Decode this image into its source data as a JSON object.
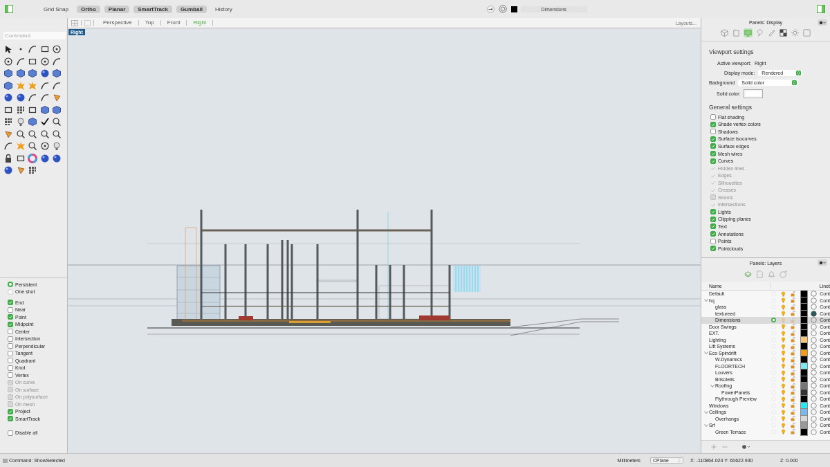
{
  "toolbar": {
    "toggles": [
      {
        "label": "Grid Snap",
        "on": false
      },
      {
        "label": "Ortho",
        "on": true
      },
      {
        "label": "Planar",
        "on": true
      },
      {
        "label": "SmartTrack",
        "on": true
      },
      {
        "label": "Gumball",
        "on": true
      },
      {
        "label": "History",
        "on": false
      }
    ],
    "current_layer": {
      "name": "Dimensions",
      "color": "#000000"
    }
  },
  "command": {
    "placeholder": "Command"
  },
  "viewport_tabs": [
    {
      "label": "Perspective",
      "selected": false
    },
    {
      "label": "Top",
      "selected": false
    },
    {
      "label": "Front",
      "selected": false
    },
    {
      "label": "Right",
      "selected": true
    }
  ],
  "layouts_button": "Layouts...",
  "viewport": {
    "label": "Right"
  },
  "osnaps": {
    "modes": [
      {
        "label": "Persistent",
        "selected": true
      },
      {
        "label": "One shot",
        "selected": false
      }
    ],
    "snaps": [
      {
        "label": "End",
        "checked": true,
        "disabled": false
      },
      {
        "label": "Near",
        "checked": false,
        "disabled": false
      },
      {
        "label": "Point",
        "checked": true,
        "disabled": false
      },
      {
        "label": "Midpoint",
        "checked": true,
        "disabled": false
      },
      {
        "label": "Center",
        "checked": false,
        "disabled": false
      },
      {
        "label": "Intersection",
        "checked": false,
        "disabled": false
      },
      {
        "label": "Perpendicular",
        "checked": false,
        "disabled": false
      },
      {
        "label": "Tangent",
        "checked": false,
        "disabled": false
      },
      {
        "label": "Quadrant",
        "checked": false,
        "disabled": false
      },
      {
        "label": "Knot",
        "checked": false,
        "disabled": false
      },
      {
        "label": "Vertex",
        "checked": false,
        "disabled": false
      },
      {
        "label": "On curve",
        "checked": false,
        "disabled": true
      },
      {
        "label": "On surface",
        "checked": false,
        "disabled": true
      },
      {
        "label": "On polysurface",
        "checked": false,
        "disabled": true
      },
      {
        "label": "On mesh",
        "checked": false,
        "disabled": true
      },
      {
        "label": "Project",
        "checked": true,
        "disabled": false
      },
      {
        "label": "SmartTrack",
        "checked": true,
        "disabled": false
      }
    ],
    "disable_all": {
      "label": "Disable all",
      "checked": false
    }
  },
  "display_panel": {
    "title": "Panels: Display",
    "icon_tabs": [
      {
        "selected": false
      },
      {
        "selected": false
      },
      {
        "selected": true
      },
      {
        "selected": false
      },
      {
        "selected": false
      },
      {
        "selected": false
      },
      {
        "selected": false
      },
      {
        "selected": false
      }
    ],
    "viewport_heading": "Viewport settings",
    "active_viewport_label": "Active viewport:",
    "active_viewport": "Right",
    "display_mode_label": "Display mode:",
    "display_mode": "Rendered",
    "background_label": "Background",
    "background": "Solid color",
    "solid_color_label": "Solid color:",
    "general_heading": "General settings",
    "options": [
      {
        "label": "Flat shading",
        "checked": false,
        "disabled": false
      },
      {
        "label": "Shade vertex colors",
        "checked": true,
        "disabled": false
      },
      {
        "label": "Shadows",
        "checked": false,
        "disabled": false
      },
      {
        "label": "Surface isocurves",
        "checked": true,
        "disabled": false
      },
      {
        "label": "Surface edges",
        "checked": true,
        "disabled": false
      },
      {
        "label": "Mesh wires",
        "checked": true,
        "disabled": false
      },
      {
        "label": "Curves",
        "checked": true,
        "disabled": false
      },
      {
        "label": "Hidden lines",
        "checked": true,
        "disabled": true
      },
      {
        "label": "Edges",
        "checked": true,
        "disabled": true
      },
      {
        "label": "Silhouettes",
        "checked": true,
        "disabled": true
      },
      {
        "label": "Creases",
        "checked": true,
        "disabled": true
      },
      {
        "label": "Seams",
        "checked": false,
        "disabled": true
      },
      {
        "label": "Intersections",
        "checked": true,
        "disabled": true
      },
      {
        "label": "Lights",
        "checked": true,
        "disabled": false
      },
      {
        "label": "Clipping planes",
        "checked": true,
        "disabled": false
      },
      {
        "label": "Text",
        "checked": true,
        "disabled": false
      },
      {
        "label": "Annotations",
        "checked": true,
        "disabled": false
      },
      {
        "label": "Points",
        "checked": false,
        "disabled": false
      },
      {
        "label": "Pointclouds",
        "checked": true,
        "disabled": false
      }
    ]
  },
  "layers_panel": {
    "title": "Panels: Layers",
    "icon_tabs": [
      {
        "selected": true
      },
      {
        "selected": false
      },
      {
        "selected": false
      },
      {
        "selected": false
      }
    ],
    "columns": [
      "Name",
      "Linet"
    ],
    "layers": [
      {
        "name": "Default",
        "current": false,
        "selected": false,
        "color": "#000000",
        "linetype": "Cont"
      },
      {
        "name": "hq",
        "current": false,
        "selected": false,
        "color": "#000000",
        "linetype": "Cont",
        "expanded": true,
        "children": [
          {
            "name": "glass",
            "current": false,
            "selected": false,
            "color": "#000000",
            "linetype": "Cont"
          },
          {
            "name": "textureed",
            "current": false,
            "selected": false,
            "color": "#000000",
            "linetype": "Cont",
            "material": true
          },
          {
            "name": "Dimensions",
            "current": true,
            "selected": true,
            "color": "#000000",
            "linetype": "Cont"
          }
        ]
      },
      {
        "name": "Door Swings",
        "current": false,
        "selected": false,
        "color": "#000000",
        "linetype": "Cont"
      },
      {
        "name": "EXT.",
        "current": false,
        "selected": false,
        "color": "#000000",
        "linetype": "Cont"
      },
      {
        "name": "Lighting",
        "current": false,
        "selected": false,
        "color": "#f5c77a",
        "linetype": "Cont"
      },
      {
        "name": "Lift Systems",
        "current": false,
        "selected": false,
        "color": "#000000",
        "linetype": "Cont"
      },
      {
        "name": "Eco Spindrift",
        "current": false,
        "selected": false,
        "color": "#f29a1e",
        "linetype": "Cont",
        "expanded": true,
        "children": [
          {
            "name": "W.Dynamics",
            "current": false,
            "selected": false,
            "color": "#000000",
            "linetype": "Cont"
          },
          {
            "name": "FLOORTECH",
            "current": false,
            "selected": false,
            "color": "#7fe8f0",
            "linetype": "Cont"
          },
          {
            "name": "Louvers",
            "current": false,
            "selected": false,
            "color": "#000000",
            "linetype": "Cont"
          },
          {
            "name": "Brisoleils",
            "current": false,
            "selected": false,
            "color": "#000000",
            "linetype": "Cont"
          },
          {
            "name": "Roofing",
            "current": false,
            "selected": false,
            "color": "#777777",
            "linetype": "Cont",
            "expanded": true,
            "children": [
              {
                "name": "PowerPanels",
                "current": false,
                "selected": false,
                "color": "#333333",
                "linetype": "Cont"
              }
            ]
          },
          {
            "name": "Flythrough Preview",
            "current": false,
            "selected": false,
            "color": "#000000",
            "linetype": "Cont"
          }
        ]
      },
      {
        "name": "Windows",
        "current": false,
        "selected": false,
        "color": "#2ee6f0",
        "linetype": "Cont"
      },
      {
        "name": "Ceilings",
        "current": false,
        "selected": false,
        "color": "#7ab8e8",
        "linetype": "Cont",
        "expanded": true,
        "children": [
          {
            "name": "Overhangs",
            "current": false,
            "selected": false,
            "color": "#d8d8d8",
            "linetype": "Cont"
          }
        ]
      },
      {
        "name": "Srf",
        "current": false,
        "selected": false,
        "color": "#999999",
        "linetype": "Cont",
        "expanded": true,
        "children": [
          {
            "name": "Green Terrace",
            "current": false,
            "selected": false,
            "color": "#000000",
            "linetype": "Cont"
          }
        ]
      }
    ]
  },
  "status_bar": {
    "command": "Command: ShowSelected",
    "units": "Millimeters",
    "plane": "CPlane",
    "coordinates": "X: -110864.024 Y: 60622.930",
    "z": "Z: 0.000"
  }
}
